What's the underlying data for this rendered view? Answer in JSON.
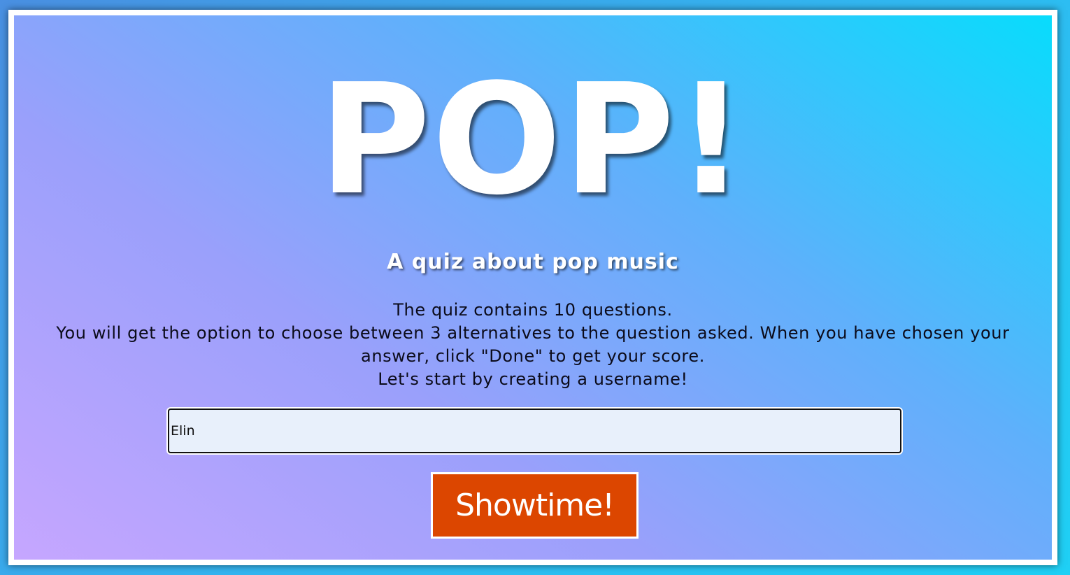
{
  "header": {
    "logo_text": "POP!",
    "subtitle": "A quiz about pop music"
  },
  "intro": {
    "line1": "The quiz contains 10 questions.",
    "line2": "You will get the option to choose between 3 alternatives to the question asked. When you have chosen your answer, click \"Done\" to get your score.",
    "line3": "Let's start by creating a username!"
  },
  "form": {
    "username_value": "Elin",
    "submit_label": "Showtime!"
  },
  "colors": {
    "button_background": "#dc4600",
    "input_background": "#e8f0fb",
    "text_white": "#ffffff"
  }
}
